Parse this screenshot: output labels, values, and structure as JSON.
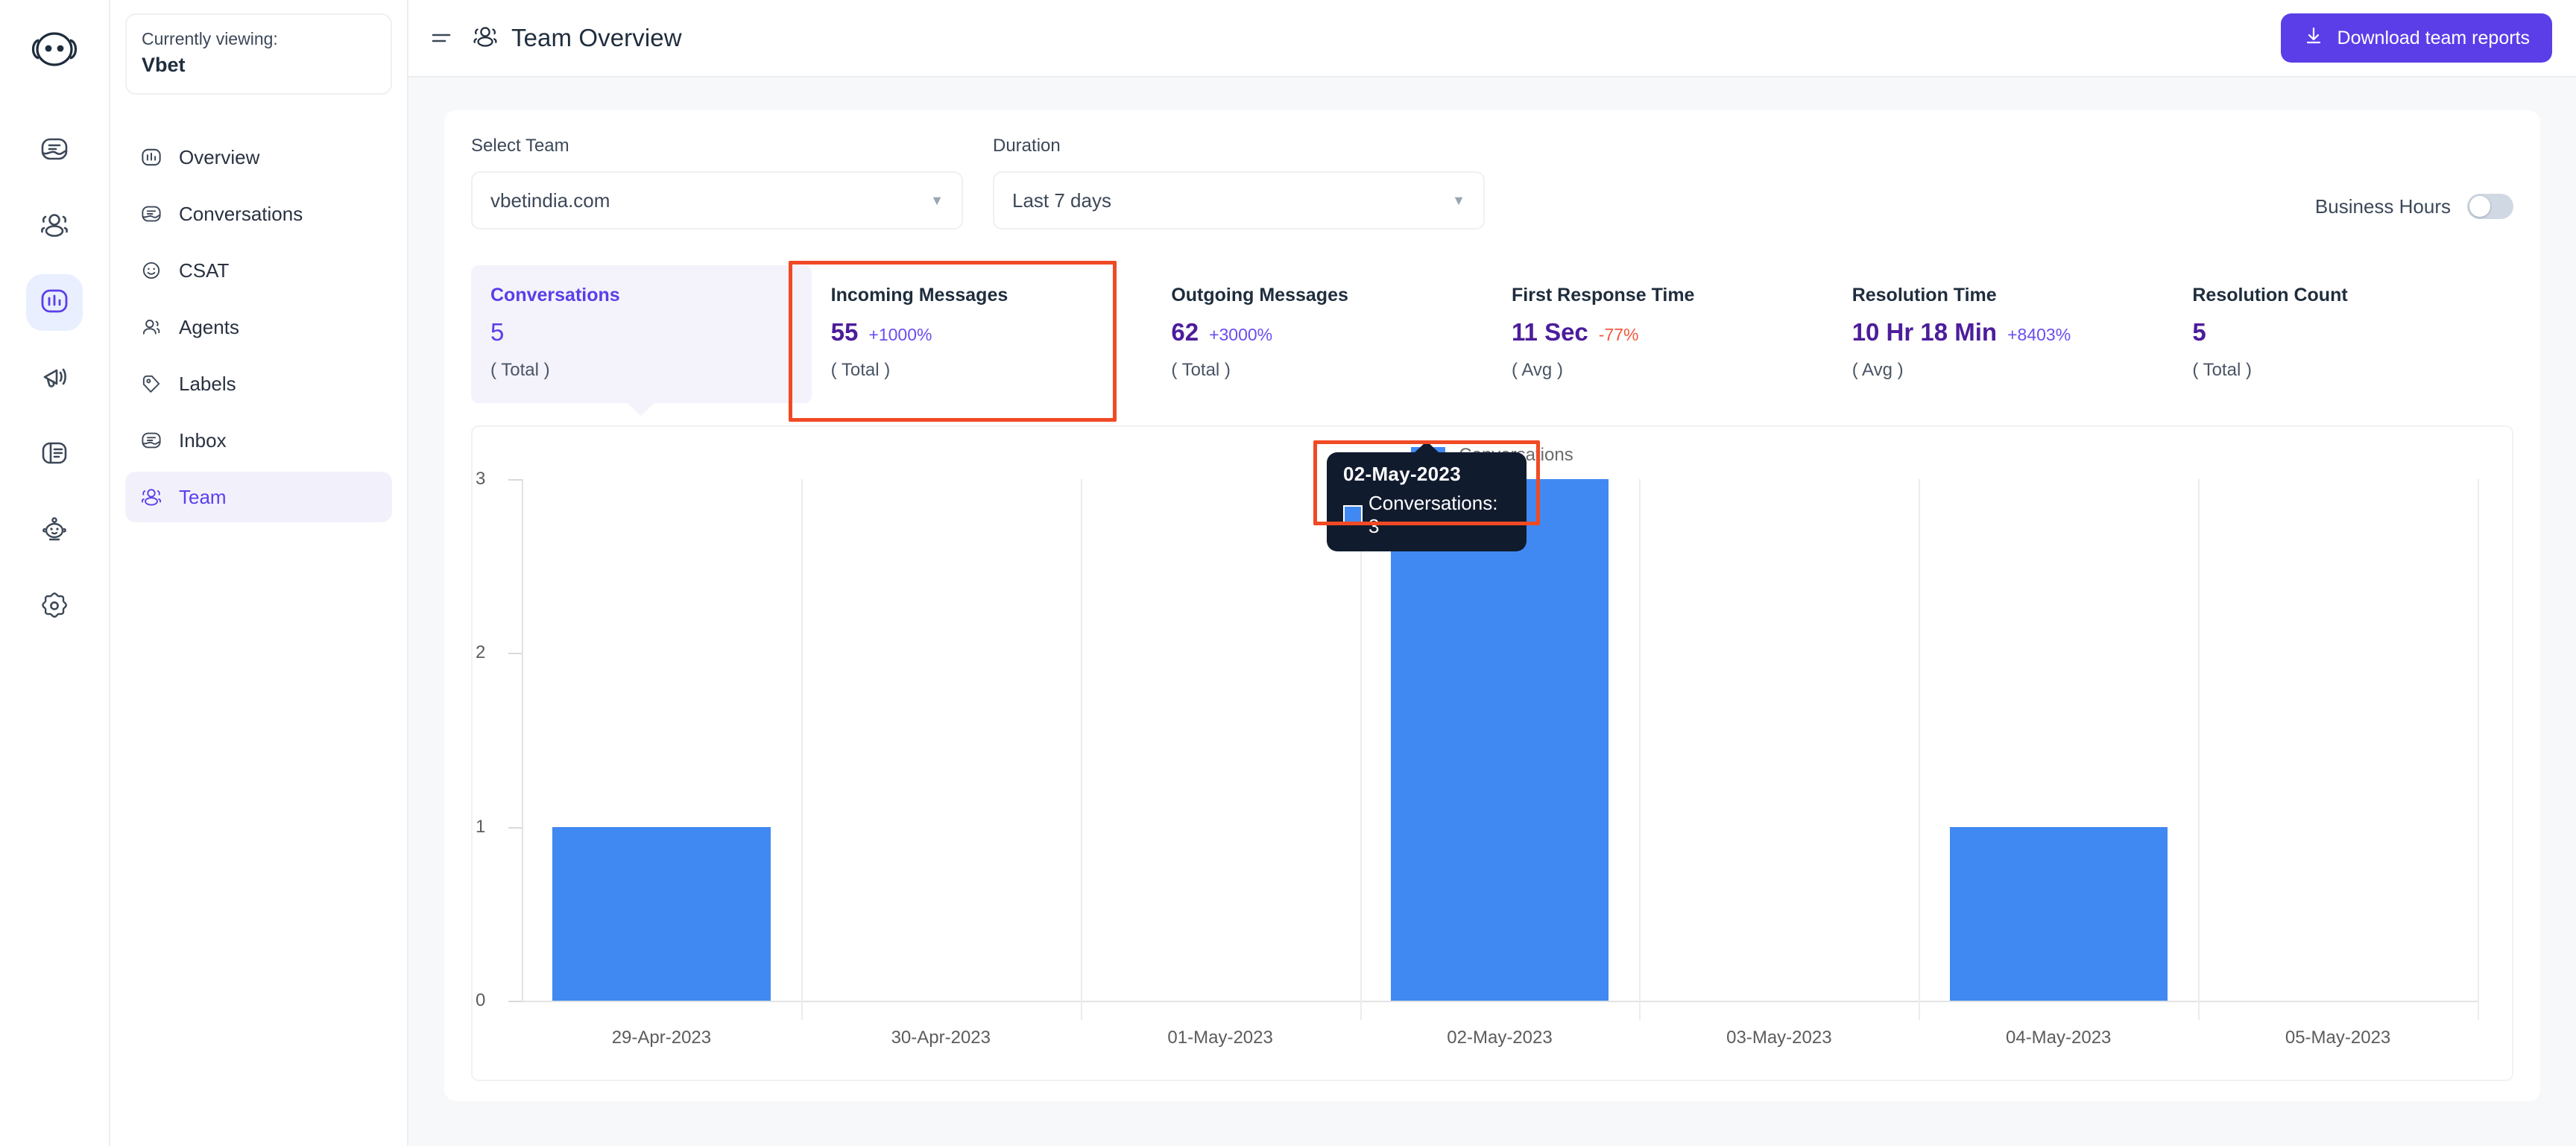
{
  "rail": {
    "logo_icon": "chatwoot-logo-icon",
    "items": [
      {
        "name": "conversations",
        "icon": "chat-bubble-icon",
        "active": false
      },
      {
        "name": "contacts",
        "icon": "people-group-icon",
        "active": false
      },
      {
        "name": "reports",
        "icon": "bar-chart-icon",
        "active": true
      },
      {
        "name": "campaigns",
        "icon": "megaphone-icon",
        "active": false
      },
      {
        "name": "help-center",
        "icon": "book-panel-icon",
        "active": false
      },
      {
        "name": "bots",
        "icon": "robot-icon",
        "active": false
      },
      {
        "name": "settings",
        "icon": "gear-icon",
        "active": false
      }
    ]
  },
  "sidebar": {
    "viewing_label": "Currently viewing:",
    "viewing_value": "Vbet",
    "items": [
      {
        "label": "Overview",
        "icon": "bar-chart-icon",
        "active": false
      },
      {
        "label": "Conversations",
        "icon": "chat-bubble-icon",
        "active": false
      },
      {
        "label": "CSAT",
        "icon": "smiley-icon",
        "active": false
      },
      {
        "label": "Agents",
        "icon": "person-icon",
        "active": false
      },
      {
        "label": "Labels",
        "icon": "tag-icon",
        "active": false
      },
      {
        "label": "Inbox",
        "icon": "inbox-icon",
        "active": false
      },
      {
        "label": "Team",
        "icon": "people-group-icon",
        "active": true
      }
    ]
  },
  "topbar": {
    "menu_icon": "hamburger-icon",
    "title_icon": "people-group-icon",
    "title": "Team Overview",
    "download_label": "Download team reports",
    "download_icon": "download-icon",
    "accent_color": "#5b3ee8"
  },
  "filters": {
    "team": {
      "label": "Select Team",
      "value": "vbetindia.com",
      "caret_icon": "chevron-down-icon"
    },
    "duration": {
      "label": "Duration",
      "value": "Last 7 days",
      "caret_icon": "chevron-down-icon"
    },
    "business_hours": {
      "label": "Business Hours",
      "enabled": false
    }
  },
  "metrics": [
    {
      "title": "Conversations",
      "value": "5",
      "delta": "",
      "delta_sign": "",
      "sub": "( Total )",
      "selected": true
    },
    {
      "title": "Incoming Messages",
      "value": "55",
      "delta": "+1000%",
      "delta_sign": "pos",
      "sub": "( Total )",
      "selected": false,
      "highlighted": true
    },
    {
      "title": "Outgoing Messages",
      "value": "62",
      "delta": "+3000%",
      "delta_sign": "pos",
      "sub": "( Total )",
      "selected": false
    },
    {
      "title": "First Response Time",
      "value": "11 Sec",
      "delta": "-77%",
      "delta_sign": "neg",
      "sub": "( Avg )",
      "selected": false
    },
    {
      "title": "Resolution Time",
      "value": "10 Hr 18 Min",
      "delta": "+8403%",
      "delta_sign": "pos",
      "sub": "( Avg )",
      "selected": false
    },
    {
      "title": "Resolution Count",
      "value": "5",
      "delta": "",
      "delta_sign": "",
      "sub": "( Total )",
      "selected": false
    }
  ],
  "tooltip": {
    "title": "02-May-2023",
    "series_label": "Conversations: 3",
    "swatch_color": "#4189f2",
    "highlight_color": "#f04a25"
  },
  "chart_data": {
    "type": "bar",
    "title": "",
    "xlabel": "",
    "ylabel": "",
    "legend": [
      "Conversations"
    ],
    "legend_position": "top-center",
    "grid": true,
    "categories": [
      "29-Apr-2023",
      "30-Apr-2023",
      "01-May-2023",
      "02-May-2023",
      "03-May-2023",
      "04-May-2023",
      "05-May-2023"
    ],
    "series": [
      {
        "name": "Conversations",
        "color": "#4189f2",
        "values": [
          1,
          0,
          0,
          3,
          0,
          1,
          0
        ]
      }
    ],
    "yticks": [
      "0",
      "1",
      "2",
      "3"
    ],
    "ylim": [
      0,
      3
    ]
  }
}
